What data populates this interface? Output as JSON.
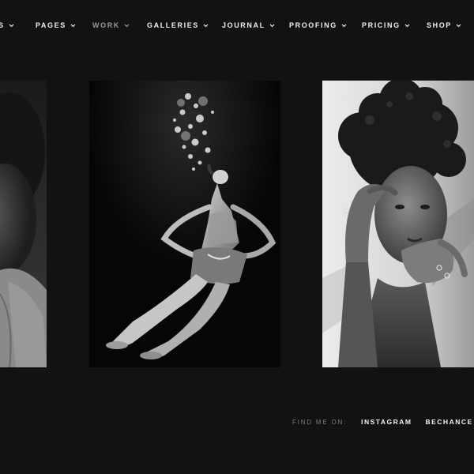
{
  "nav": {
    "items": [
      {
        "label": "S",
        "muted": false
      },
      {
        "label": "PAGES",
        "muted": false
      },
      {
        "label": "WORK",
        "muted": true
      },
      {
        "label": "GALLERIES",
        "muted": false
      },
      {
        "label": "JOURNAL",
        "muted": false
      },
      {
        "label": "PROOFING",
        "muted": false
      },
      {
        "label": "PRICING",
        "muted": false
      },
      {
        "label": "SHOP",
        "muted": false
      }
    ]
  },
  "gallery": {
    "photos": [
      {
        "subject": "partially visible black and white portrait of a person"
      },
      {
        "subject": "black and white underwater portrait of a woman with bubbles"
      },
      {
        "subject": "black and white portrait of a woman with curly hair touching her face"
      }
    ]
  },
  "footer": {
    "find_label": "FIND ME ON:",
    "links": [
      "INSTAGRAM",
      "BECHANCE"
    ]
  },
  "colors": {
    "background": "#121212",
    "nav_text": "#f0f0f0",
    "nav_muted": "#9a9a9a",
    "footer_label": "#7d7d7d"
  }
}
